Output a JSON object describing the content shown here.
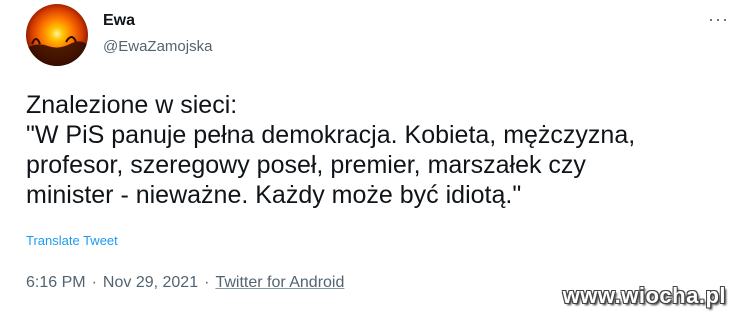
{
  "author": {
    "name": "Ewa",
    "handle": "@EwaZamojska"
  },
  "more_icon": "more-horizontal-icon",
  "tweet": {
    "lines": [
      "Znalezione w sieci:",
      "\"W PiS panuje pełna demokracja. Kobieta, mężczyzna,",
      "profesor, szeregowy poseł, premier, marszałek czy",
      "minister - nieważne. Każdy może być idiotą.\""
    ],
    "translate_label": "Translate Tweet"
  },
  "meta": {
    "time": "6:16 PM",
    "separator": "·",
    "date": "Nov 29, 2021",
    "source": "Twitter for Android"
  },
  "watermark": "www.wiocha.pl",
  "colors": {
    "link": "#1d9bf0",
    "secondary_text": "#536471",
    "primary_text": "#0f1419"
  }
}
